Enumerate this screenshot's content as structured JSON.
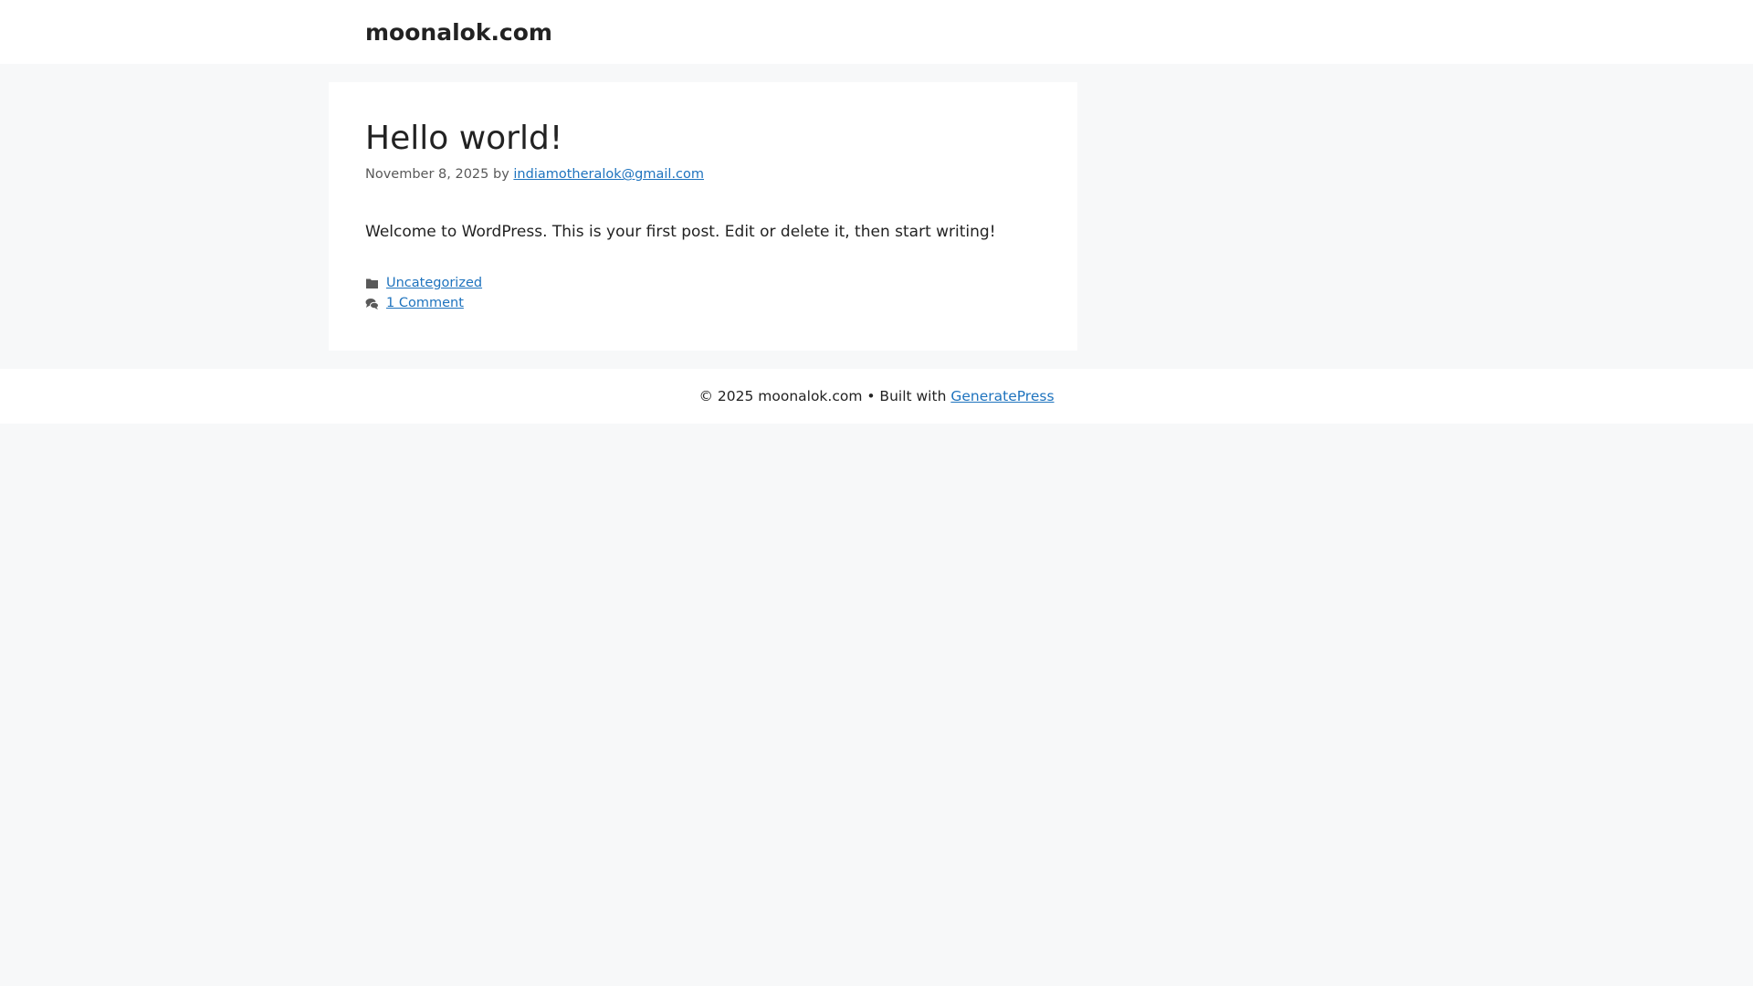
{
  "header": {
    "site_title": "moonalok.com"
  },
  "post": {
    "title": "Hello world!",
    "date": "November 8, 2025",
    "by_label": "by",
    "author": "indiamotheralok@gmail.com",
    "content": "Welcome to WordPress. This is your first post. Edit or delete it, then start writing!",
    "category": "Uncategorized",
    "comments": "1 Comment"
  },
  "footer": {
    "copyright": "© 2025 moonalok.com • Built with",
    "theme_link": "GeneratePress"
  },
  "colors": {
    "link": "#1e73be",
    "background": "#f7f8f9",
    "surface": "#ffffff",
    "text": "#222222",
    "meta_text": "#595959"
  },
  "icons": {
    "category": "folder-icon",
    "comments": "comments-icon"
  }
}
